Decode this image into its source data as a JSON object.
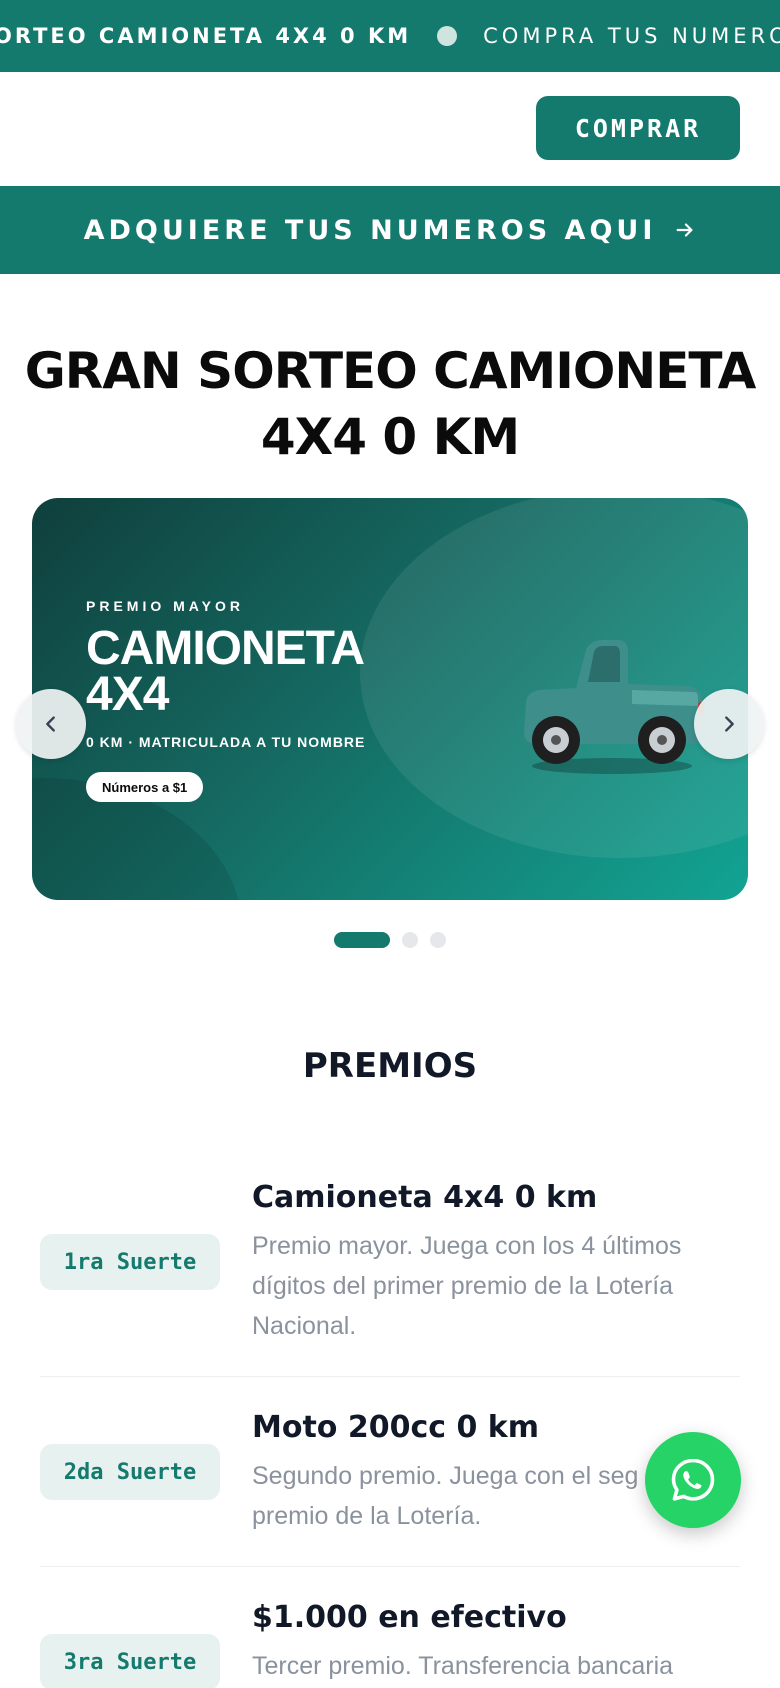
{
  "marquee": {
    "item_1": "ORTEO CAMIONETA 4X4 0 KM",
    "item_2": "COMPRA TUS NUMEROS A"
  },
  "header": {
    "buy_label": "COMPRAR"
  },
  "cta": {
    "label": "ADQUIERE TUS NUMEROS AQUI",
    "arrow_icon": "arrow-right-icon"
  },
  "page_title": "GRAN SORTEO CAMIONETA 4X4 0 KM",
  "carousel": {
    "kicker": "PREMIO MAYOR",
    "heading": "CAMIONETA 4X4",
    "subtitle": "0 KM · MATRICULADA A TU NOMBRE",
    "pill": "Números a $1",
    "image_icon": "pickup-truck-icon",
    "slide_count": 3,
    "active_slide": 1
  },
  "prizes": {
    "title": "PREMIOS",
    "items": [
      {
        "badge": "1ra Suerte",
        "name": "Camioneta 4x4 0 km",
        "desc": "Premio mayor. Juega con los 4 últimos dígitos del primer premio de la Lotería Nacional."
      },
      {
        "badge": "2da Suerte",
        "name": "Moto 200cc 0 km",
        "desc": "Segundo premio. Juega con el seg premio de la Lotería."
      },
      {
        "badge": "3ra Suerte",
        "name": "$1.000 en efectivo",
        "desc": "Tercer premio. Transferencia bancaria"
      }
    ]
  },
  "colors": {
    "brand": "#157a6e",
    "badge_bg": "#e7f1ef",
    "whatsapp": "#25d366"
  },
  "floating": {
    "icon": "whatsapp-icon"
  }
}
